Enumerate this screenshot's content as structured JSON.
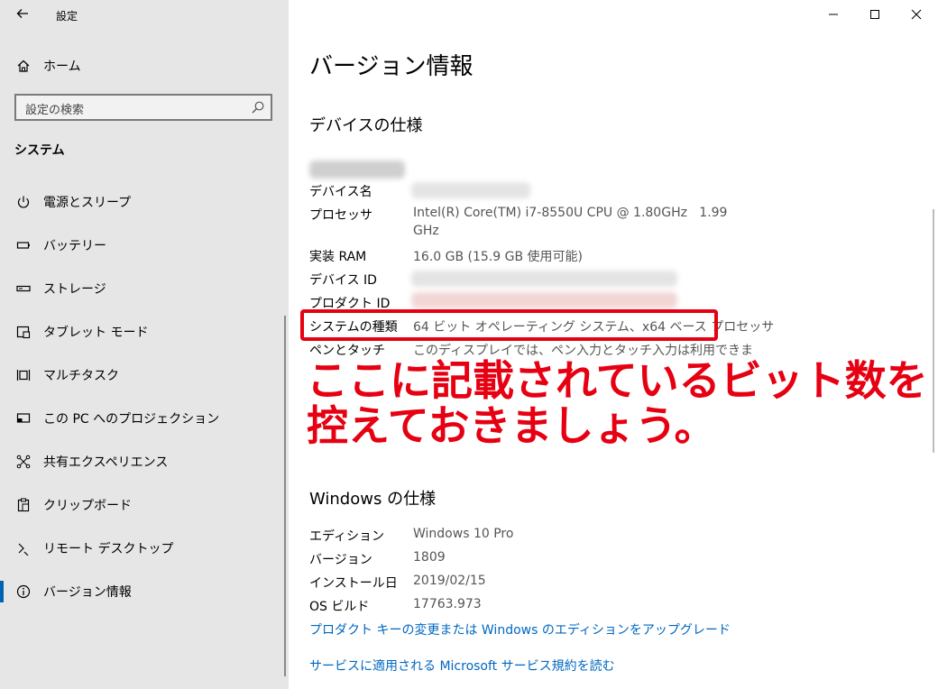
{
  "window": {
    "title": "設定"
  },
  "sidebar": {
    "home_label": "ホーム",
    "search_placeholder": "設定の検索",
    "section_title": "システム",
    "items": [
      {
        "label": "電源とスリープ",
        "icon": "power-icon"
      },
      {
        "label": "バッテリー",
        "icon": "battery-icon"
      },
      {
        "label": "ストレージ",
        "icon": "storage-icon"
      },
      {
        "label": "タブレット モード",
        "icon": "tablet-icon"
      },
      {
        "label": "マルチタスク",
        "icon": "multitask-icon"
      },
      {
        "label": "この PC へのプロジェクション",
        "icon": "projection-icon"
      },
      {
        "label": "共有エクスペリエンス",
        "icon": "share-icon"
      },
      {
        "label": "クリップボード",
        "icon": "clipboard-icon"
      },
      {
        "label": "リモート デスクトップ",
        "icon": "remote-desktop-icon"
      },
      {
        "label": "バージョン情報",
        "icon": "info-icon",
        "active": true
      }
    ]
  },
  "main": {
    "title": "バージョン情報",
    "device_spec": {
      "heading": "デバイスの仕様",
      "rows": [
        {
          "label": "デバイス名",
          "value": ""
        },
        {
          "label": "プロセッサ",
          "value_line1": "Intel(R) Core(TM) i7-8550U CPU @ 1.80GHz   1.99",
          "value_line2": "GHz"
        },
        {
          "label": "実装 RAM",
          "value": "16.0 GB (15.9 GB 使用可能)"
        },
        {
          "label": "デバイス ID",
          "value": ""
        },
        {
          "label": "プロダクト ID",
          "value": ""
        },
        {
          "label": "システムの種類",
          "value": "64 ビット オペレーティング システム、x64 ベース プロセッサ"
        },
        {
          "label": "ペンとタッチ",
          "value": "このディスプレイでは、ペン入力とタッチ入力は利用できま"
        }
      ]
    },
    "windows_spec": {
      "heading": "Windows の仕様",
      "rows": [
        {
          "label": "エディション",
          "value": "Windows 10 Pro"
        },
        {
          "label": "バージョン",
          "value": "1809"
        },
        {
          "label": "インストール日",
          "value": "2019/02/15"
        },
        {
          "label": "OS ビルド",
          "value": "17763.973"
        }
      ]
    },
    "links": [
      "プロダクト キーの変更または Windows のエディションをアップグレード",
      "サービスに適用される Microsoft サービス規約を読む"
    ]
  },
  "annotation": {
    "line1": "ここに記載されているビット数を",
    "line2": "控えておきましょう。"
  },
  "colors": {
    "accent": "#0067c0",
    "highlight_red": "#e60012",
    "sidebar_bg": "#e6e6e6"
  }
}
